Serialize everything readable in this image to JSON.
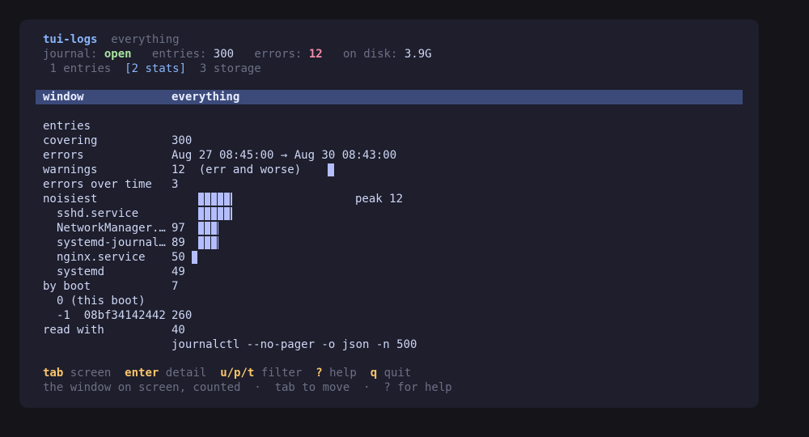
{
  "header": {
    "app_name": "tui-logs",
    "view_name": "everything",
    "journal_label": "journal:",
    "journal_value": "open",
    "entries_label": "entries:",
    "entries_value": "300",
    "errors_label": "errors:",
    "errors_value": "12",
    "disk_label": "on disk:",
    "disk_value": "3.9G"
  },
  "tabs": [
    {
      "label": "1 entries",
      "active": false
    },
    {
      "label": "[2 stats]",
      "active": true
    },
    {
      "label": "3 storage",
      "active": false
    }
  ],
  "stats": {
    "header_label": "window",
    "header_value": "everything",
    "entries_label": "entries",
    "entries_value": "300",
    "covering_label": "covering",
    "covering_value": "Aug 27 08:45:00 → Aug 30 08:43:00",
    "errors_label": "errors",
    "errors_value": "12  (err and worse)",
    "warnings_label": "warnings",
    "warnings_value": "3",
    "errors_over_time_label": "errors over time",
    "errors_over_time_peak": "peak 12",
    "errors_over_time_spark": [
      0,
      0,
      0,
      0,
      0,
      0,
      0,
      0,
      0,
      0,
      0,
      0,
      0,
      0,
      0,
      0,
      0,
      0,
      0,
      0,
      0,
      0,
      0,
      12,
      0,
      0,
      0,
      0
    ],
    "noisiest_label": "noisiest",
    "noisiest": [
      {
        "unit": "sshd.service",
        "count": "97",
        "value": 97
      },
      {
        "unit": "NetworkManager.…",
        "count": "89",
        "value": 89
      },
      {
        "unit": "systemd-journal…",
        "count": "50",
        "value": 50
      },
      {
        "unit": "nginx.service",
        "count": "49",
        "value": 49
      },
      {
        "unit": "systemd",
        "count": "7",
        "value": 7
      }
    ],
    "by_boot_label": "by boot",
    "boots": [
      {
        "label": "0 (this boot)",
        "count": "260"
      },
      {
        "label": "-1  08bf34142442",
        "count": "40"
      }
    ],
    "read_with_label": "read with",
    "read_with_value": "journalctl --no-pager -o json -n 500"
  },
  "footer": {
    "keys": [
      {
        "key": "tab",
        "desc": "screen"
      },
      {
        "key": "enter",
        "desc": "detail"
      },
      {
        "key": "u/p/t",
        "desc": "filter"
      },
      {
        "key": "?",
        "desc": "help"
      },
      {
        "key": "q",
        "desc": "quit"
      }
    ],
    "hint": "the window on screen, counted  ·  tab to move  ·  ? for help"
  },
  "colors": {
    "background": "#1e1e2c",
    "selection": "#3c4a7a",
    "accent": "#89b4fa",
    "ok": "#a6e3a1",
    "error": "#f38ba8",
    "key": "#f9c56b",
    "bar": "#b4befe"
  }
}
